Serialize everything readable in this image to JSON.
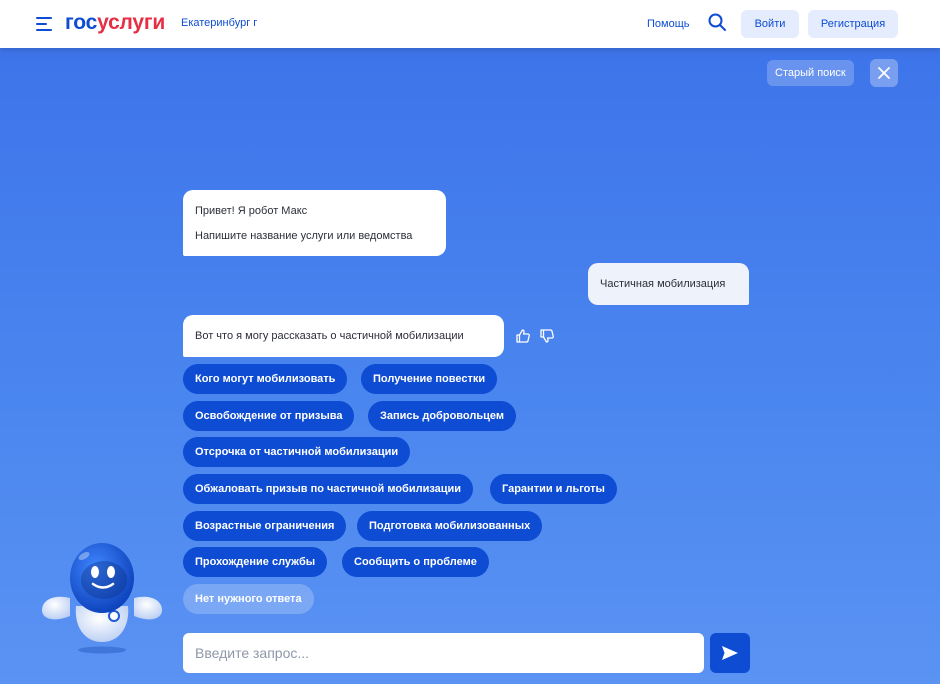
{
  "header": {
    "logo_part1": "гос",
    "logo_part2": "услуги",
    "city": "Екатеринбург г",
    "help": "Помощь",
    "login": "Войти",
    "register": "Регистрация"
  },
  "chat": {
    "old_search": "Старый поиск",
    "greeting_line1": "Привет! Я робот Макс",
    "greeting_line2": "Напишите название услуги или ведомства",
    "user_message": "Частичная мобилизация",
    "answer": "Вот что я могу рассказать о частичной мобилизации",
    "chips": [
      "Кого могут мобилизовать",
      "Получение повестки",
      "Освобождение от призыва",
      "Запись добровольцем",
      "Отсрочка от частичной мобилизации",
      "Обжаловать призыв по частичной мобилизации",
      "Гарантии и льготы",
      "Возрастные ограничения",
      "Подготовка мобилизованных",
      "Прохождение службы",
      "Сообщить о проблеме",
      "Нет нужного ответа"
    ],
    "input_placeholder": "Введите запрос..."
  },
  "icons": {
    "menu": "menu-icon",
    "search": "search-icon",
    "close": "close-icon",
    "thumbs_up": "thumbs-up-icon",
    "thumbs_down": "thumbs-down-icon",
    "send": "send-icon",
    "robot": "robot-max-avatar"
  },
  "colors": {
    "brand_blue": "#0d4cd3",
    "brand_red": "#e62f45",
    "background_blue": "#4a86ef"
  }
}
